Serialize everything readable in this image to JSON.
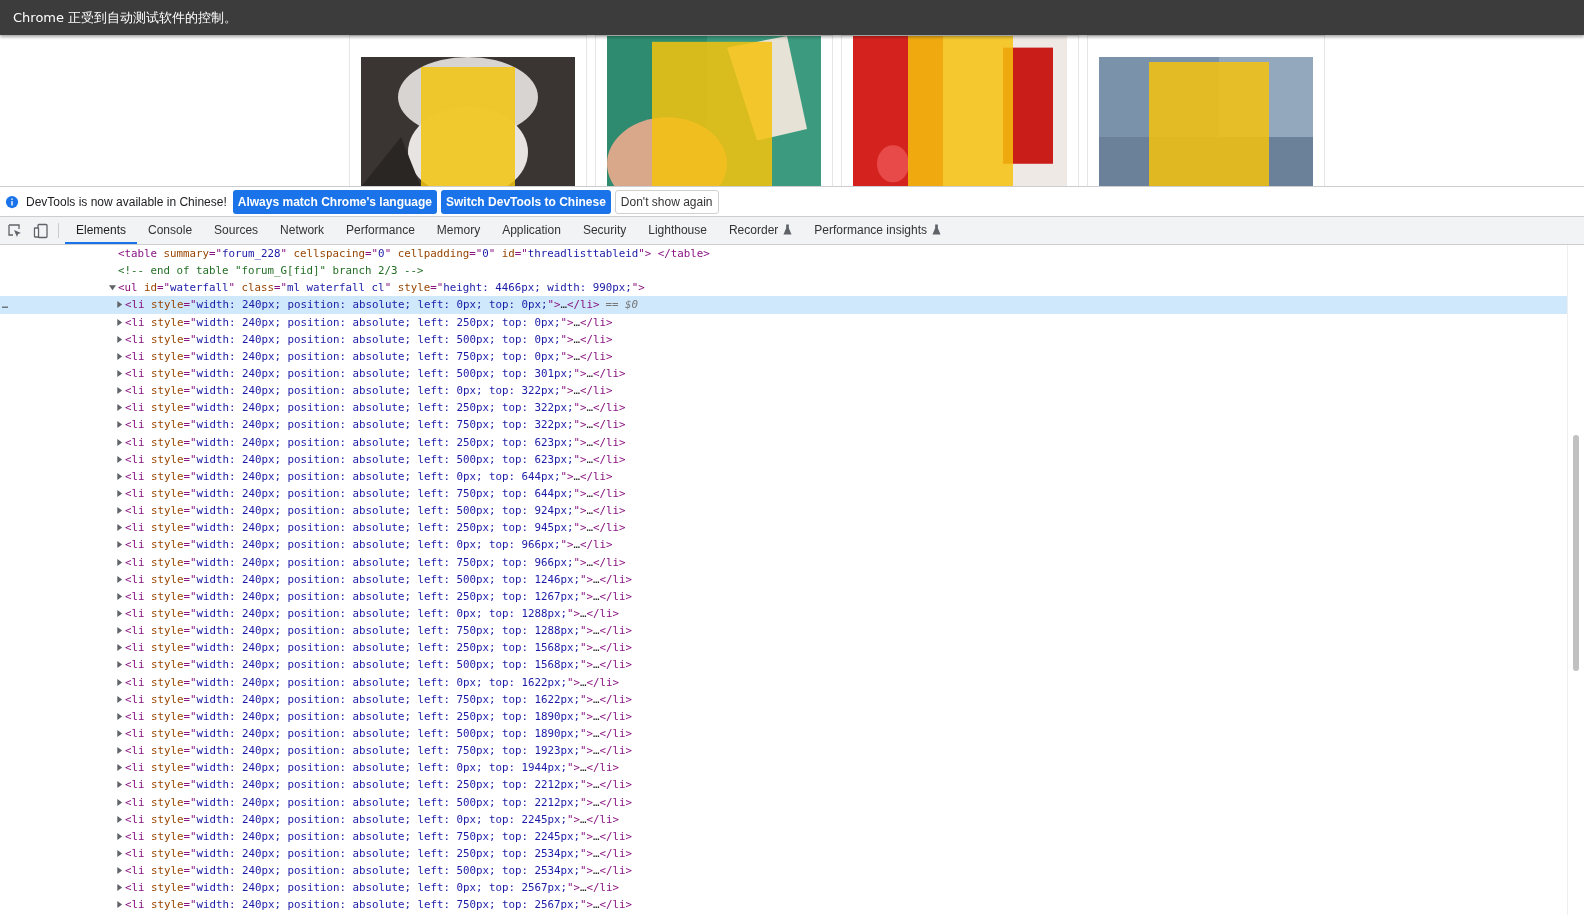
{
  "automation_bar": {
    "message": "Chrome 正受到自动测试软件的控制。"
  },
  "infobar": {
    "message": "DevTools is now available in Chinese!",
    "buttons": [
      {
        "label": "Always match Chrome's language",
        "primary": true
      },
      {
        "label": "Switch DevTools to Chinese",
        "primary": true
      },
      {
        "label": "Don't show again",
        "primary": false
      }
    ]
  },
  "tabs": [
    {
      "label": "Elements",
      "selected": true,
      "experimental": false
    },
    {
      "label": "Console",
      "selected": false,
      "experimental": false
    },
    {
      "label": "Sources",
      "selected": false,
      "experimental": false
    },
    {
      "label": "Network",
      "selected": false,
      "experimental": false
    },
    {
      "label": "Performance",
      "selected": false,
      "experimental": false
    },
    {
      "label": "Memory",
      "selected": false,
      "experimental": false
    },
    {
      "label": "Application",
      "selected": false,
      "experimental": false
    },
    {
      "label": "Security",
      "selected": false,
      "experimental": false
    },
    {
      "label": "Lighthouse",
      "selected": false,
      "experimental": false
    },
    {
      "label": "Recorder",
      "selected": false,
      "experimental": true
    },
    {
      "label": "Performance insights",
      "selected": false,
      "experimental": true
    }
  ],
  "nodes": [
    {
      "selected": false,
      "tokens": [
        {
          "kind": "tag",
          "text": "<table"
        },
        {
          "kind": "attr",
          "text": " summary"
        },
        {
          "kind": "tag",
          "text": "=\""
        },
        {
          "kind": "val",
          "text": "forum_228"
        },
        {
          "kind": "tag",
          "text": "\""
        },
        {
          "kind": "attr",
          "text": " cellspacing"
        },
        {
          "kind": "tag",
          "text": "=\""
        },
        {
          "kind": "val",
          "text": "0"
        },
        {
          "kind": "tag",
          "text": "\""
        },
        {
          "kind": "attr",
          "text": " cellpadding"
        },
        {
          "kind": "tag",
          "text": "=\""
        },
        {
          "kind": "val",
          "text": "0"
        },
        {
          "kind": "tag",
          "text": "\""
        },
        {
          "kind": "attr",
          "text": " id"
        },
        {
          "kind": "tag",
          "text": "=\""
        },
        {
          "kind": "val",
          "text": "threadlisttableid"
        },
        {
          "kind": "tag",
          "text": "\"> </table>"
        }
      ]
    },
    {
      "selected": false,
      "tokens": [
        {
          "kind": "comment",
          "text": "<!-- end of table \"forum_G[fid]\" branch 2/3 -->"
        }
      ]
    },
    {
      "selected": false,
      "expanded": true,
      "tokens": [
        {
          "kind": "tag",
          "text": "<ul"
        },
        {
          "kind": "attr",
          "text": " id"
        },
        {
          "kind": "tag",
          "text": "=\""
        },
        {
          "kind": "val",
          "text": "waterfall"
        },
        {
          "kind": "tag",
          "text": "\""
        },
        {
          "kind": "attr",
          "text": " class"
        },
        {
          "kind": "tag",
          "text": "=\""
        },
        {
          "kind": "val",
          "text": "ml waterfall cl"
        },
        {
          "kind": "tag",
          "text": "\""
        },
        {
          "kind": "attr",
          "text": " style"
        },
        {
          "kind": "tag",
          "text": "=\""
        },
        {
          "kind": "val",
          "text": "height: 4466px; width: 990px;"
        },
        {
          "kind": "tag",
          "text": "\">"
        }
      ],
      "children": [
        {
          "selected": true,
          "expanded": false,
          "marker": "…",
          "suffix": "== $0",
          "tokens": [
            {
              "kind": "tag",
              "text": "<li"
            },
            {
              "kind": "attr",
              "text": " style"
            },
            {
              "kind": "tag",
              "text": "=\""
            },
            {
              "kind": "val",
              "text": "width: 240px; position: absolute; left: 0px; top: 0px;"
            },
            {
              "kind": "tag",
              "text": "\">"
            },
            {
              "kind": "plain",
              "text": "…"
            },
            {
              "kind": "tag",
              "text": "</li>"
            }
          ]
        },
        {
          "selected": false,
          "expanded": false,
          "tokens": [
            {
              "kind": "tag",
              "text": "<li"
            },
            {
              "kind": "attr",
              "text": " style"
            },
            {
              "kind": "tag",
              "text": "=\""
            },
            {
              "kind": "val",
              "text": "width: 240px; position: absolute; left: 250px; top: 0px;"
            },
            {
              "kind": "tag",
              "text": "\">"
            },
            {
              "kind": "plain",
              "text": "…"
            },
            {
              "kind": "tag",
              "text": "</li>"
            }
          ]
        },
        {
          "selected": false,
          "expanded": false,
          "tokens": [
            {
              "kind": "tag",
              "text": "<li"
            },
            {
              "kind": "attr",
              "text": " style"
            },
            {
              "kind": "tag",
              "text": "=\""
            },
            {
              "kind": "val",
              "text": "width: 240px; position: absolute; left: 500px; top: 0px;"
            },
            {
              "kind": "tag",
              "text": "\">"
            },
            {
              "kind": "plain",
              "text": "…"
            },
            {
              "kind": "tag",
              "text": "</li>"
            }
          ]
        },
        {
          "selected": false,
          "expanded": false,
          "tokens": [
            {
              "kind": "tag",
              "text": "<li"
            },
            {
              "kind": "attr",
              "text": " style"
            },
            {
              "kind": "tag",
              "text": "=\""
            },
            {
              "kind": "val",
              "text": "width: 240px; position: absolute; left: 750px; top: 0px;"
            },
            {
              "kind": "tag",
              "text": "\">"
            },
            {
              "kind": "plain",
              "text": "…"
            },
            {
              "kind": "tag",
              "text": "</li>"
            }
          ]
        },
        {
          "selected": false,
          "expanded": false,
          "tokens": [
            {
              "kind": "tag",
              "text": "<li"
            },
            {
              "kind": "attr",
              "text": " style"
            },
            {
              "kind": "tag",
              "text": "=\""
            },
            {
              "kind": "val",
              "text": "width: 240px; position: absolute; left: 500px; top: 301px;"
            },
            {
              "kind": "tag",
              "text": "\">"
            },
            {
              "kind": "plain",
              "text": "…"
            },
            {
              "kind": "tag",
              "text": "</li>"
            }
          ]
        },
        {
          "selected": false,
          "expanded": false,
          "tokens": [
            {
              "kind": "tag",
              "text": "<li"
            },
            {
              "kind": "attr",
              "text": " style"
            },
            {
              "kind": "tag",
              "text": "=\""
            },
            {
              "kind": "val",
              "text": "width: 240px; position: absolute; left: 0px; top: 322px;"
            },
            {
              "kind": "tag",
              "text": "\">"
            },
            {
              "kind": "plain",
              "text": "…"
            },
            {
              "kind": "tag",
              "text": "</li>"
            }
          ]
        },
        {
          "selected": false,
          "expanded": false,
          "tokens": [
            {
              "kind": "tag",
              "text": "<li"
            },
            {
              "kind": "attr",
              "text": " style"
            },
            {
              "kind": "tag",
              "text": "=\""
            },
            {
              "kind": "val",
              "text": "width: 240px; position: absolute; left: 250px; top: 322px;"
            },
            {
              "kind": "tag",
              "text": "\">"
            },
            {
              "kind": "plain",
              "text": "…"
            },
            {
              "kind": "tag",
              "text": "</li>"
            }
          ]
        },
        {
          "selected": false,
          "expanded": false,
          "tokens": [
            {
              "kind": "tag",
              "text": "<li"
            },
            {
              "kind": "attr",
              "text": " style"
            },
            {
              "kind": "tag",
              "text": "=\""
            },
            {
              "kind": "val",
              "text": "width: 240px; position: absolute; left: 750px; top: 322px;"
            },
            {
              "kind": "tag",
              "text": "\">"
            },
            {
              "kind": "plain",
              "text": "…"
            },
            {
              "kind": "tag",
              "text": "</li>"
            }
          ]
        },
        {
          "selected": false,
          "expanded": false,
          "tokens": [
            {
              "kind": "tag",
              "text": "<li"
            },
            {
              "kind": "attr",
              "text": " style"
            },
            {
              "kind": "tag",
              "text": "=\""
            },
            {
              "kind": "val",
              "text": "width: 240px; position: absolute; left: 250px; top: 623px;"
            },
            {
              "kind": "tag",
              "text": "\">"
            },
            {
              "kind": "plain",
              "text": "…"
            },
            {
              "kind": "tag",
              "text": "</li>"
            }
          ]
        },
        {
          "selected": false,
          "expanded": false,
          "tokens": [
            {
              "kind": "tag",
              "text": "<li"
            },
            {
              "kind": "attr",
              "text": " style"
            },
            {
              "kind": "tag",
              "text": "=\""
            },
            {
              "kind": "val",
              "text": "width: 240px; position: absolute; left: 500px; top: 623px;"
            },
            {
              "kind": "tag",
              "text": "\">"
            },
            {
              "kind": "plain",
              "text": "…"
            },
            {
              "kind": "tag",
              "text": "</li>"
            }
          ]
        },
        {
          "selected": false,
          "expanded": false,
          "tokens": [
            {
              "kind": "tag",
              "text": "<li"
            },
            {
              "kind": "attr",
              "text": " style"
            },
            {
              "kind": "tag",
              "text": "=\""
            },
            {
              "kind": "val",
              "text": "width: 240px; position: absolute; left: 0px; top: 644px;"
            },
            {
              "kind": "tag",
              "text": "\">"
            },
            {
              "kind": "plain",
              "text": "…"
            },
            {
              "kind": "tag",
              "text": "</li>"
            }
          ]
        },
        {
          "selected": false,
          "expanded": false,
          "tokens": [
            {
              "kind": "tag",
              "text": "<li"
            },
            {
              "kind": "attr",
              "text": " style"
            },
            {
              "kind": "tag",
              "text": "=\""
            },
            {
              "kind": "val",
              "text": "width: 240px; position: absolute; left: 750px; top: 644px;"
            },
            {
              "kind": "tag",
              "text": "\">"
            },
            {
              "kind": "plain",
              "text": "…"
            },
            {
              "kind": "tag",
              "text": "</li>"
            }
          ]
        },
        {
          "selected": false,
          "expanded": false,
          "tokens": [
            {
              "kind": "tag",
              "text": "<li"
            },
            {
              "kind": "attr",
              "text": " style"
            },
            {
              "kind": "tag",
              "text": "=\""
            },
            {
              "kind": "val",
              "text": "width: 240px; position: absolute; left: 500px; top: 924px;"
            },
            {
              "kind": "tag",
              "text": "\">"
            },
            {
              "kind": "plain",
              "text": "…"
            },
            {
              "kind": "tag",
              "text": "</li>"
            }
          ]
        },
        {
          "selected": false,
          "expanded": false,
          "tokens": [
            {
              "kind": "tag",
              "text": "<li"
            },
            {
              "kind": "attr",
              "text": " style"
            },
            {
              "kind": "tag",
              "text": "=\""
            },
            {
              "kind": "val",
              "text": "width: 240px; position: absolute; left: 250px; top: 945px;"
            },
            {
              "kind": "tag",
              "text": "\">"
            },
            {
              "kind": "plain",
              "text": "…"
            },
            {
              "kind": "tag",
              "text": "</li>"
            }
          ]
        },
        {
          "selected": false,
          "expanded": false,
          "tokens": [
            {
              "kind": "tag",
              "text": "<li"
            },
            {
              "kind": "attr",
              "text": " style"
            },
            {
              "kind": "tag",
              "text": "=\""
            },
            {
              "kind": "val",
              "text": "width: 240px; position: absolute; left: 0px; top: 966px;"
            },
            {
              "kind": "tag",
              "text": "\">"
            },
            {
              "kind": "plain",
              "text": "…"
            },
            {
              "kind": "tag",
              "text": "</li>"
            }
          ]
        },
        {
          "selected": false,
          "expanded": false,
          "tokens": [
            {
              "kind": "tag",
              "text": "<li"
            },
            {
              "kind": "attr",
              "text": " style"
            },
            {
              "kind": "tag",
              "text": "=\""
            },
            {
              "kind": "val",
              "text": "width: 240px; position: absolute; left: 750px; top: 966px;"
            },
            {
              "kind": "tag",
              "text": "\">"
            },
            {
              "kind": "plain",
              "text": "…"
            },
            {
              "kind": "tag",
              "text": "</li>"
            }
          ]
        },
        {
          "selected": false,
          "expanded": false,
          "tokens": [
            {
              "kind": "tag",
              "text": "<li"
            },
            {
              "kind": "attr",
              "text": " style"
            },
            {
              "kind": "tag",
              "text": "=\""
            },
            {
              "kind": "val",
              "text": "width: 240px; position: absolute; left: 500px; top: 1246px;"
            },
            {
              "kind": "tag",
              "text": "\">"
            },
            {
              "kind": "plain",
              "text": "…"
            },
            {
              "kind": "tag",
              "text": "</li>"
            }
          ]
        },
        {
          "selected": false,
          "expanded": false,
          "tokens": [
            {
              "kind": "tag",
              "text": "<li"
            },
            {
              "kind": "attr",
              "text": " style"
            },
            {
              "kind": "tag",
              "text": "=\""
            },
            {
              "kind": "val",
              "text": "width: 240px; position: absolute; left: 250px; top: 1267px;"
            },
            {
              "kind": "tag",
              "text": "\">"
            },
            {
              "kind": "plain",
              "text": "…"
            },
            {
              "kind": "tag",
              "text": "</li>"
            }
          ]
        },
        {
          "selected": false,
          "expanded": false,
          "tokens": [
            {
              "kind": "tag",
              "text": "<li"
            },
            {
              "kind": "attr",
              "text": " style"
            },
            {
              "kind": "tag",
              "text": "=\""
            },
            {
              "kind": "val",
              "text": "width: 240px; position: absolute; left: 0px; top: 1288px;"
            },
            {
              "kind": "tag",
              "text": "\">"
            },
            {
              "kind": "plain",
              "text": "…"
            },
            {
              "kind": "tag",
              "text": "</li>"
            }
          ]
        },
        {
          "selected": false,
          "expanded": false,
          "tokens": [
            {
              "kind": "tag",
              "text": "<li"
            },
            {
              "kind": "attr",
              "text": " style"
            },
            {
              "kind": "tag",
              "text": "=\""
            },
            {
              "kind": "val",
              "text": "width: 240px; position: absolute; left: 750px; top: 1288px;"
            },
            {
              "kind": "tag",
              "text": "\">"
            },
            {
              "kind": "plain",
              "text": "…"
            },
            {
              "kind": "tag",
              "text": "</li>"
            }
          ]
        },
        {
          "selected": false,
          "expanded": false,
          "tokens": [
            {
              "kind": "tag",
              "text": "<li"
            },
            {
              "kind": "attr",
              "text": " style"
            },
            {
              "kind": "tag",
              "text": "=\""
            },
            {
              "kind": "val",
              "text": "width: 240px; position: absolute; left: 250px; top: 1568px;"
            },
            {
              "kind": "tag",
              "text": "\">"
            },
            {
              "kind": "plain",
              "text": "…"
            },
            {
              "kind": "tag",
              "text": "</li>"
            }
          ]
        },
        {
          "selected": false,
          "expanded": false,
          "tokens": [
            {
              "kind": "tag",
              "text": "<li"
            },
            {
              "kind": "attr",
              "text": " style"
            },
            {
              "kind": "tag",
              "text": "=\""
            },
            {
              "kind": "val",
              "text": "width: 240px; position: absolute; left: 500px; top: 1568px;"
            },
            {
              "kind": "tag",
              "text": "\">"
            },
            {
              "kind": "plain",
              "text": "…"
            },
            {
              "kind": "tag",
              "text": "</li>"
            }
          ]
        },
        {
          "selected": false,
          "expanded": false,
          "tokens": [
            {
              "kind": "tag",
              "text": "<li"
            },
            {
              "kind": "attr",
              "text": " style"
            },
            {
              "kind": "tag",
              "text": "=\""
            },
            {
              "kind": "val",
              "text": "width: 240px; position: absolute; left: 0px; top: 1622px;"
            },
            {
              "kind": "tag",
              "text": "\">"
            },
            {
              "kind": "plain",
              "text": "…"
            },
            {
              "kind": "tag",
              "text": "</li>"
            }
          ]
        },
        {
          "selected": false,
          "expanded": false,
          "tokens": [
            {
              "kind": "tag",
              "text": "<li"
            },
            {
              "kind": "attr",
              "text": " style"
            },
            {
              "kind": "tag",
              "text": "=\""
            },
            {
              "kind": "val",
              "text": "width: 240px; position: absolute; left: 750px; top: 1622px;"
            },
            {
              "kind": "tag",
              "text": "\">"
            },
            {
              "kind": "plain",
              "text": "…"
            },
            {
              "kind": "tag",
              "text": "</li>"
            }
          ]
        },
        {
          "selected": false,
          "expanded": false,
          "tokens": [
            {
              "kind": "tag",
              "text": "<li"
            },
            {
              "kind": "attr",
              "text": " style"
            },
            {
              "kind": "tag",
              "text": "=\""
            },
            {
              "kind": "val",
              "text": "width: 240px; position: absolute; left: 250px; top: 1890px;"
            },
            {
              "kind": "tag",
              "text": "\">"
            },
            {
              "kind": "plain",
              "text": "…"
            },
            {
              "kind": "tag",
              "text": "</li>"
            }
          ]
        },
        {
          "selected": false,
          "expanded": false,
          "tokens": [
            {
              "kind": "tag",
              "text": "<li"
            },
            {
              "kind": "attr",
              "text": " style"
            },
            {
              "kind": "tag",
              "text": "=\""
            },
            {
              "kind": "val",
              "text": "width: 240px; position: absolute; left: 500px; top: 1890px;"
            },
            {
              "kind": "tag",
              "text": "\">"
            },
            {
              "kind": "plain",
              "text": "…"
            },
            {
              "kind": "tag",
              "text": "</li>"
            }
          ]
        },
        {
          "selected": false,
          "expanded": false,
          "tokens": [
            {
              "kind": "tag",
              "text": "<li"
            },
            {
              "kind": "attr",
              "text": " style"
            },
            {
              "kind": "tag",
              "text": "=\""
            },
            {
              "kind": "val",
              "text": "width: 240px; position: absolute; left: 750px; top: 1923px;"
            },
            {
              "kind": "tag",
              "text": "\">"
            },
            {
              "kind": "plain",
              "text": "…"
            },
            {
              "kind": "tag",
              "text": "</li>"
            }
          ]
        },
        {
          "selected": false,
          "expanded": false,
          "tokens": [
            {
              "kind": "tag",
              "text": "<li"
            },
            {
              "kind": "attr",
              "text": " style"
            },
            {
              "kind": "tag",
              "text": "=\""
            },
            {
              "kind": "val",
              "text": "width: 240px; position: absolute; left: 0px; top: 1944px;"
            },
            {
              "kind": "tag",
              "text": "\">"
            },
            {
              "kind": "plain",
              "text": "…"
            },
            {
              "kind": "tag",
              "text": "</li>"
            }
          ]
        },
        {
          "selected": false,
          "expanded": false,
          "tokens": [
            {
              "kind": "tag",
              "text": "<li"
            },
            {
              "kind": "attr",
              "text": " style"
            },
            {
              "kind": "tag",
              "text": "=\""
            },
            {
              "kind": "val",
              "text": "width: 240px; position: absolute; left: 250px; top: 2212px;"
            },
            {
              "kind": "tag",
              "text": "\">"
            },
            {
              "kind": "plain",
              "text": "…"
            },
            {
              "kind": "tag",
              "text": "</li>"
            }
          ]
        },
        {
          "selected": false,
          "expanded": false,
          "tokens": [
            {
              "kind": "tag",
              "text": "<li"
            },
            {
              "kind": "attr",
              "text": " style"
            },
            {
              "kind": "tag",
              "text": "=\""
            },
            {
              "kind": "val",
              "text": "width: 240px; position: absolute; left: 500px; top: 2212px;"
            },
            {
              "kind": "tag",
              "text": "\">"
            },
            {
              "kind": "plain",
              "text": "…"
            },
            {
              "kind": "tag",
              "text": "</li>"
            }
          ]
        },
        {
          "selected": false,
          "expanded": false,
          "tokens": [
            {
              "kind": "tag",
              "text": "<li"
            },
            {
              "kind": "attr",
              "text": " style"
            },
            {
              "kind": "tag",
              "text": "=\""
            },
            {
              "kind": "val",
              "text": "width: 240px; position: absolute; left: 0px; top: 2245px;"
            },
            {
              "kind": "tag",
              "text": "\">"
            },
            {
              "kind": "plain",
              "text": "…"
            },
            {
              "kind": "tag",
              "text": "</li>"
            }
          ]
        },
        {
          "selected": false,
          "expanded": false,
          "tokens": [
            {
              "kind": "tag",
              "text": "<li"
            },
            {
              "kind": "attr",
              "text": " style"
            },
            {
              "kind": "tag",
              "text": "=\""
            },
            {
              "kind": "val",
              "text": "width: 240px; position: absolute; left: 750px; top: 2245px;"
            },
            {
              "kind": "tag",
              "text": "\">"
            },
            {
              "kind": "plain",
              "text": "…"
            },
            {
              "kind": "tag",
              "text": "</li>"
            }
          ]
        },
        {
          "selected": false,
          "expanded": false,
          "tokens": [
            {
              "kind": "tag",
              "text": "<li"
            },
            {
              "kind": "attr",
              "text": " style"
            },
            {
              "kind": "tag",
              "text": "=\""
            },
            {
              "kind": "val",
              "text": "width: 240px; position: absolute; left: 250px; top: 2534px;"
            },
            {
              "kind": "tag",
              "text": "\">"
            },
            {
              "kind": "plain",
              "text": "…"
            },
            {
              "kind": "tag",
              "text": "</li>"
            }
          ]
        },
        {
          "selected": false,
          "expanded": false,
          "tokens": [
            {
              "kind": "tag",
              "text": "<li"
            },
            {
              "kind": "attr",
              "text": " style"
            },
            {
              "kind": "tag",
              "text": "=\""
            },
            {
              "kind": "val",
              "text": "width: 240px; position: absolute; left: 500px; top: 2534px;"
            },
            {
              "kind": "tag",
              "text": "\">"
            },
            {
              "kind": "plain",
              "text": "…"
            },
            {
              "kind": "tag",
              "text": "</li>"
            }
          ]
        },
        {
          "selected": false,
          "expanded": false,
          "tokens": [
            {
              "kind": "tag",
              "text": "<li"
            },
            {
              "kind": "attr",
              "text": " style"
            },
            {
              "kind": "tag",
              "text": "=\""
            },
            {
              "kind": "val",
              "text": "width: 240px; position: absolute; left: 0px; top: 2567px;"
            },
            {
              "kind": "tag",
              "text": "\">"
            },
            {
              "kind": "plain",
              "text": "…"
            },
            {
              "kind": "tag",
              "text": "</li>"
            }
          ]
        },
        {
          "selected": false,
          "expanded": false,
          "tokens": [
            {
              "kind": "tag",
              "text": "<li"
            },
            {
              "kind": "attr",
              "text": " style"
            },
            {
              "kind": "tag",
              "text": "=\""
            },
            {
              "kind": "val",
              "text": "width: 240px; position: absolute; left: 750px; top: 2567px;"
            },
            {
              "kind": "tag",
              "text": "\">"
            },
            {
              "kind": "plain",
              "text": "…"
            },
            {
              "kind": "tag",
              "text": "</li>"
            }
          ]
        }
      ]
    }
  ]
}
